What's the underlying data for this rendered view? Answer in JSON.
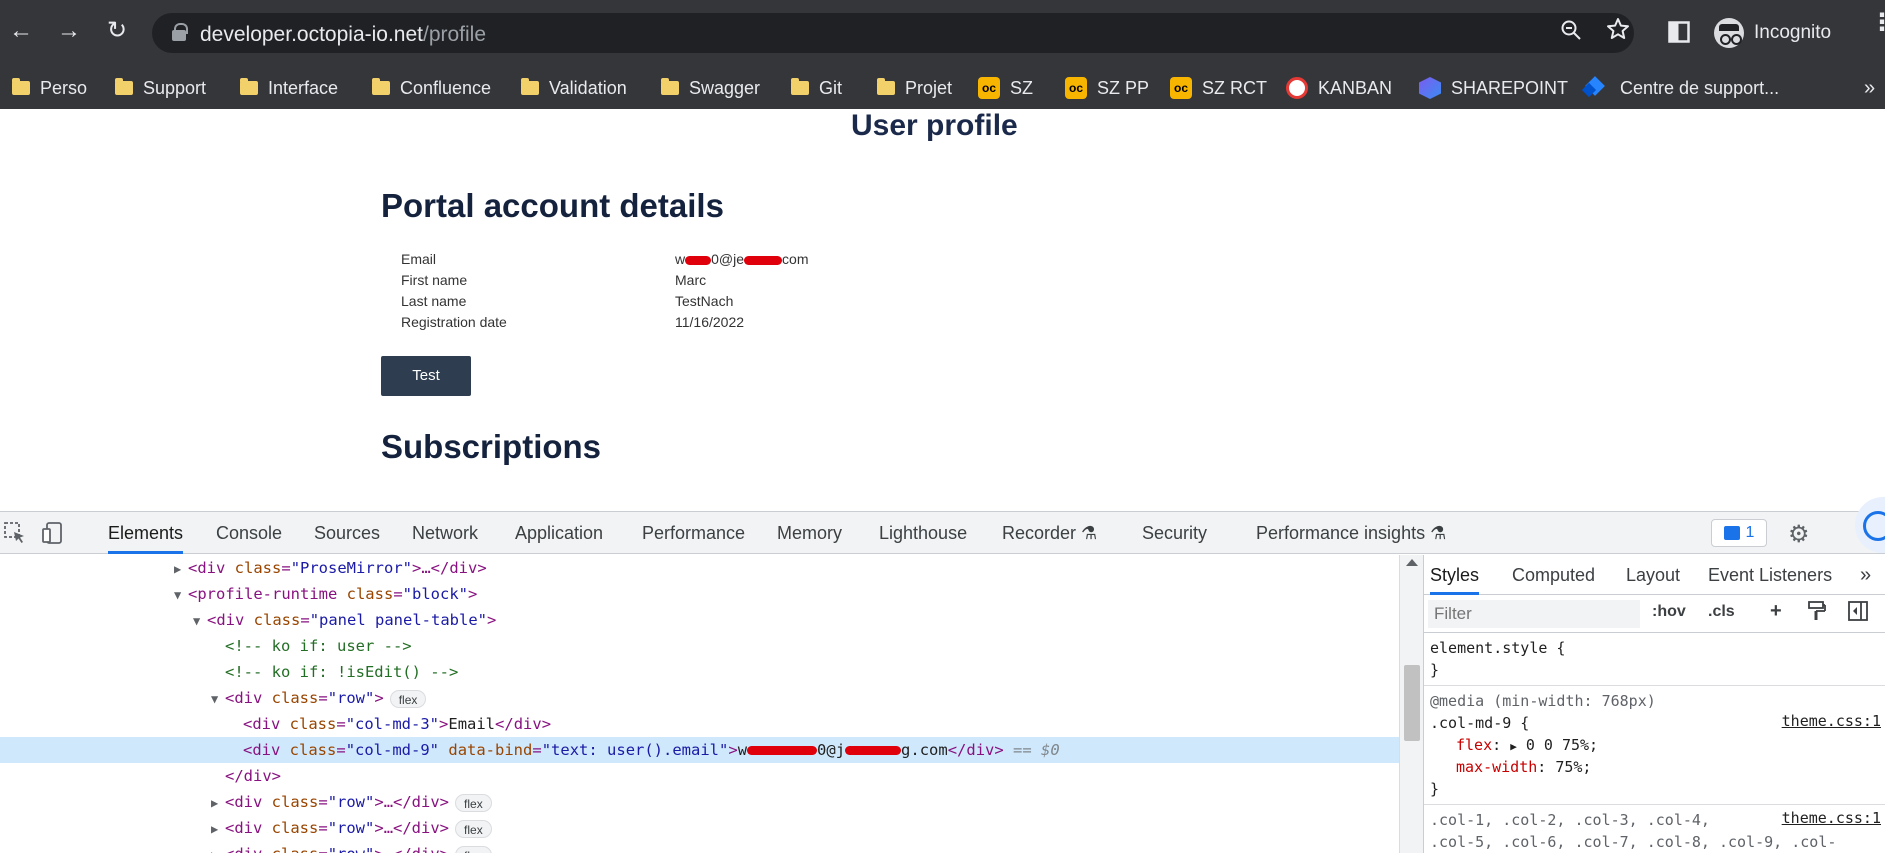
{
  "browser": {
    "url_host": "developer.octopia-io.net",
    "url_path": "/profile",
    "profile_label": "Incognito",
    "bookmarks": [
      {
        "label": "Perso",
        "icon": "folder-icon"
      },
      {
        "label": "Support",
        "icon": "folder-icon"
      },
      {
        "label": "Interface",
        "icon": "folder-icon"
      },
      {
        "label": "Confluence",
        "icon": "folder-icon"
      },
      {
        "label": "Validation",
        "icon": "folder-icon"
      },
      {
        "label": "Swagger",
        "icon": "folder-icon"
      },
      {
        "label": "Git",
        "icon": "folder-icon"
      },
      {
        "label": "Projet",
        "icon": "folder-icon"
      },
      {
        "label": "SZ",
        "icon": "octopia-icon"
      },
      {
        "label": "SZ PP",
        "icon": "octopia-icon"
      },
      {
        "label": "SZ RCT",
        "icon": "octopia-icon"
      },
      {
        "label": "KANBAN",
        "icon": "kanban-icon"
      },
      {
        "label": "SHAREPOINT",
        "icon": "sharepoint-icon"
      },
      {
        "label": "Centre de support...",
        "icon": "jira-icon"
      }
    ],
    "more_bookmarks": "»",
    "oc_glyph": "oc"
  },
  "page": {
    "title": "User profile",
    "section_account": "Portal account details",
    "fields": [
      {
        "label": "Email",
        "value_a": "w",
        "value_b": "0@je",
        "value_c": "com"
      },
      {
        "label": "First name",
        "value": "Marc"
      },
      {
        "label": "Last name",
        "value": "TestNach"
      },
      {
        "label": "Registration date",
        "value": "11/16/2022"
      }
    ],
    "test_button": "Test",
    "section_subscriptions": "Subscriptions"
  },
  "devtools": {
    "tabs": [
      "Elements",
      "Console",
      "Sources",
      "Network",
      "Application",
      "Performance",
      "Memory",
      "Lighthouse",
      "Recorder",
      "Security",
      "Performance insights"
    ],
    "issues_count": "1",
    "dom": {
      "l1_open": "<div ",
      "l1_attr": "class",
      "l1_val": "\"ProseMirror\"",
      "l1_rest": ">…</div>",
      "l2_open": "<profile-runtime ",
      "l2_attr": "class",
      "l2_val": "\"block\"",
      "l2_rest": ">",
      "l3_open": "<div ",
      "l3_attr": "class",
      "l3_val": "\"panel panel-table\"",
      "l3_rest": ">",
      "l4": "<!-- ko if: user -->",
      "l5": "<!-- ko if: !isEdit() -->",
      "l6_open": "<div ",
      "l6_attr": "class",
      "l6_val": "\"row\"",
      "l6_rest": ">",
      "l7_open": "<div ",
      "l7_attr": "class",
      "l7_val": "\"col-md-3\"",
      "l7_close_open": ">",
      "l7_text": "Email",
      "l7_close": "</div>",
      "l8_open": "<div ",
      "l8_attr1": "class",
      "l8_val1": "\"col-md-9\"",
      "l8_attr2": "data-bind",
      "l8_val2": "\"text: user().email\"",
      "l8_gt": ">",
      "l8_text_a": "w",
      "l8_text_b": "0@j",
      "l8_text_c": "g.com",
      "l8_close": "</div>",
      "l8_eq": "== $0",
      "l9": "</div>",
      "l10_open": "<div ",
      "l10_attr": "class",
      "l10_val": "\"row\"",
      "l10_rest": ">…</div>",
      "l11_open": "<div ",
      "l11_attr": "class",
      "l11_val": "\"row\"",
      "l11_rest": ">…</div>",
      "l12_open": "<div ",
      "l12_attr": "class",
      "l12_val": "\"row\"",
      "l12_rest": ">…</div>",
      "flex_pill": "flex"
    },
    "styles": {
      "tabs": [
        "Styles",
        "Computed",
        "Layout",
        "Event Listeners"
      ],
      "filter_placeholder": "Filter",
      "hov": ":hov",
      "cls": ".cls",
      "element_style": "element.style {",
      "close_brace": "}",
      "media": "@media (min-width: 768px)",
      "selector": ".col-md-9 {",
      "prop1_name": "flex",
      "prop1_value": "0 0 75%;",
      "prop2_name": "max-width",
      "prop2_value": "75%;",
      "source": "theme.css:1",
      "selector2": ".col-1, .col-2, .col-3, .col-4,",
      "selector2b": ".col-5, .col-6, .col-7, .col-8, .col-9, .col-"
    }
  },
  "colors": {
    "brand_navy": "#14223d",
    "button_bg": "#2e3e50",
    "redaction": "#e0000b",
    "devtools_accent": "#1a73e8",
    "selected_row": "#cfe8fc"
  }
}
